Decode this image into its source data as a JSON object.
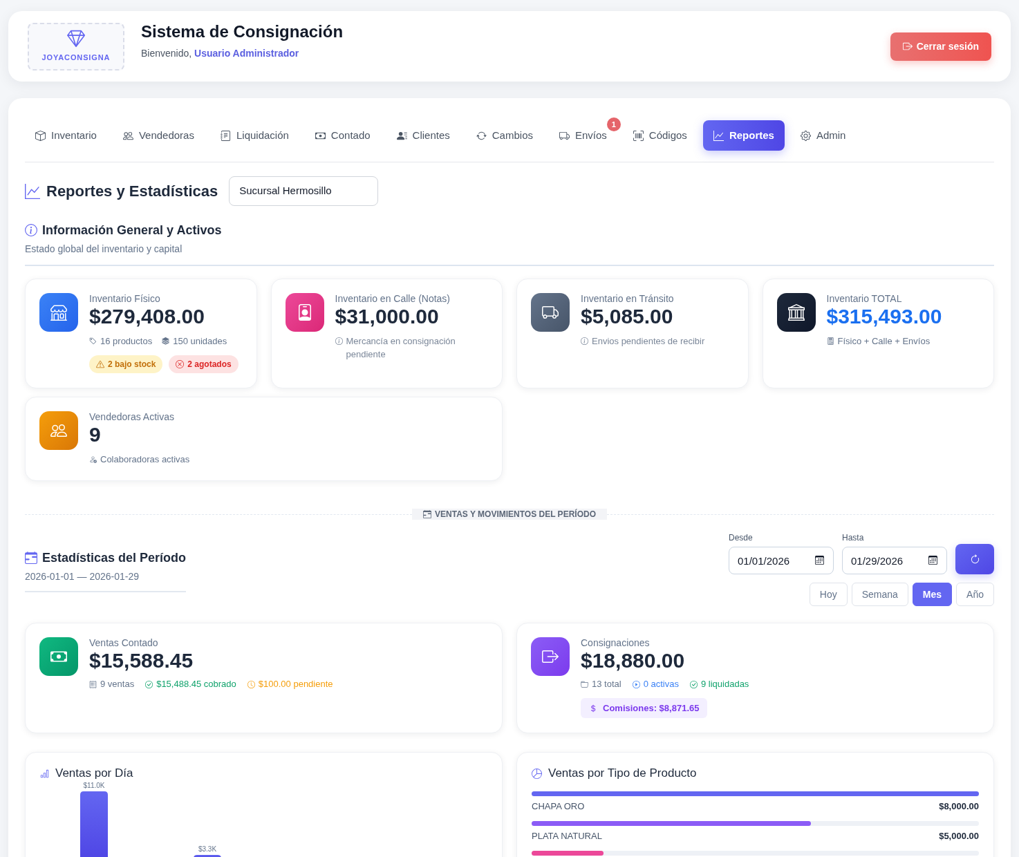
{
  "header": {
    "logo_text": "JOYACONSIGNA",
    "title": "Sistema de Consignación",
    "greeting": "Bienvenido, **Usuario Administrador**",
    "logout": "Cerrar sesión"
  },
  "tabs": [
    {
      "label": "Inventario",
      "selected": false
    },
    {
      "label": "Vendedoras",
      "selected": false
    },
    {
      "label": "Liquidación",
      "selected": false
    },
    {
      "label": "Contado",
      "selected": false
    },
    {
      "label": "Clientes",
      "selected": false
    },
    {
      "label": "Cambios",
      "selected": false
    },
    {
      "label": "Envíos",
      "selected": false,
      "badge": "1"
    },
    {
      "label": "Códigos",
      "selected": false
    },
    {
      "label": "Reportes",
      "selected": true
    },
    {
      "label": "Admin",
      "selected": false
    }
  ],
  "page": {
    "title": "Reportes y Estadísticas",
    "branch": "Sucursal Hermosillo"
  },
  "general": {
    "title": "Información General y Activos",
    "subtitle": "Estado global del inventario y capital",
    "cards": [
      {
        "kind": "physical",
        "label": "Inventario Físico",
        "value": "$279,408.00",
        "details": [
          {
            "kind": "products",
            "text": "16 productos"
          },
          {
            "kind": "units",
            "text": "150 unidades"
          }
        ],
        "badges": [
          {
            "kind": "warning",
            "text": "2 bajo stock"
          },
          {
            "kind": "danger",
            "text": "2 agotados"
          }
        ]
      },
      {
        "kind": "street",
        "label": "Inventario en Calle (Notas)",
        "value": "$31,000.00",
        "details": [
          {
            "kind": "info",
            "text": "Mercancía en consignación pendiente"
          }
        ]
      },
      {
        "kind": "transit",
        "label": "Inventario en Tránsito",
        "value": "$5,085.00",
        "details": [
          {
            "kind": "info",
            "text": "Envios pendientes de recibir"
          }
        ]
      },
      {
        "kind": "total",
        "label": "Inventario TOTAL",
        "value": "$315,493.00",
        "details": [
          {
            "kind": "formula",
            "text": "Físico + Calle + Envíos"
          }
        ]
      },
      {
        "kind": "sellers",
        "label": "Vendedoras Activas",
        "value": "9",
        "details": [
          {
            "kind": "people",
            "text": "Colaboradoras activas"
          }
        ]
      }
    ]
  },
  "section_divider": "VENTAS Y MOVIMIENTOS DEL PERÍODO",
  "period": {
    "title": "Estadísticas del Período",
    "range": "2026-01-01 — 2026-01-29",
    "from": {
      "label": "Desde",
      "value": "01/01/2026"
    },
    "to": {
      "label": "Hasta",
      "value": "01/29/2026"
    },
    "presets": [
      {
        "label": "Hoy",
        "selected": false
      },
      {
        "label": "Semana",
        "selected": false
      },
      {
        "label": "Mes",
        "selected": true
      },
      {
        "label": "Año",
        "selected": false
      }
    ],
    "cards": [
      {
        "kind": "cash",
        "label": "Ventas Contado",
        "value": "$15,588.45",
        "meta": [
          {
            "kind": "count",
            "text": "9 ventas"
          },
          {
            "kind": "paid",
            "text": "$15,488.45 cobrado"
          },
          {
            "kind": "pending",
            "text": "$100.00 pendiente"
          }
        ]
      },
      {
        "kind": "consignment",
        "label": "Consignaciones",
        "value": "$18,880.00",
        "meta": [
          {
            "kind": "total",
            "text": "13 total"
          },
          {
            "kind": "active",
            "text": "0 activas"
          },
          {
            "kind": "settled",
            "text": "9 liquidadas"
          }
        ],
        "commission": "Comisiones: $8,871.65"
      }
    ]
  },
  "charts": {
    "daily": {
      "title": "Ventas por Día",
      "bar_labels": [
        "$11.0K",
        "$3.3K"
      ]
    },
    "by_type": {
      "title": "Ventas por Tipo de Producto",
      "items": [
        {
          "name": "CHAPA ORO",
          "amount": "$8,000.00",
          "level": 1,
          "color": "#6366f1"
        },
        {
          "name": "PLATA NATURAL",
          "amount": "$5,000.00",
          "level": 0.625,
          "color": "#8b5cf6"
        },
        {
          "level": 0.16,
          "color": "#ec4899"
        }
      ]
    }
  }
}
